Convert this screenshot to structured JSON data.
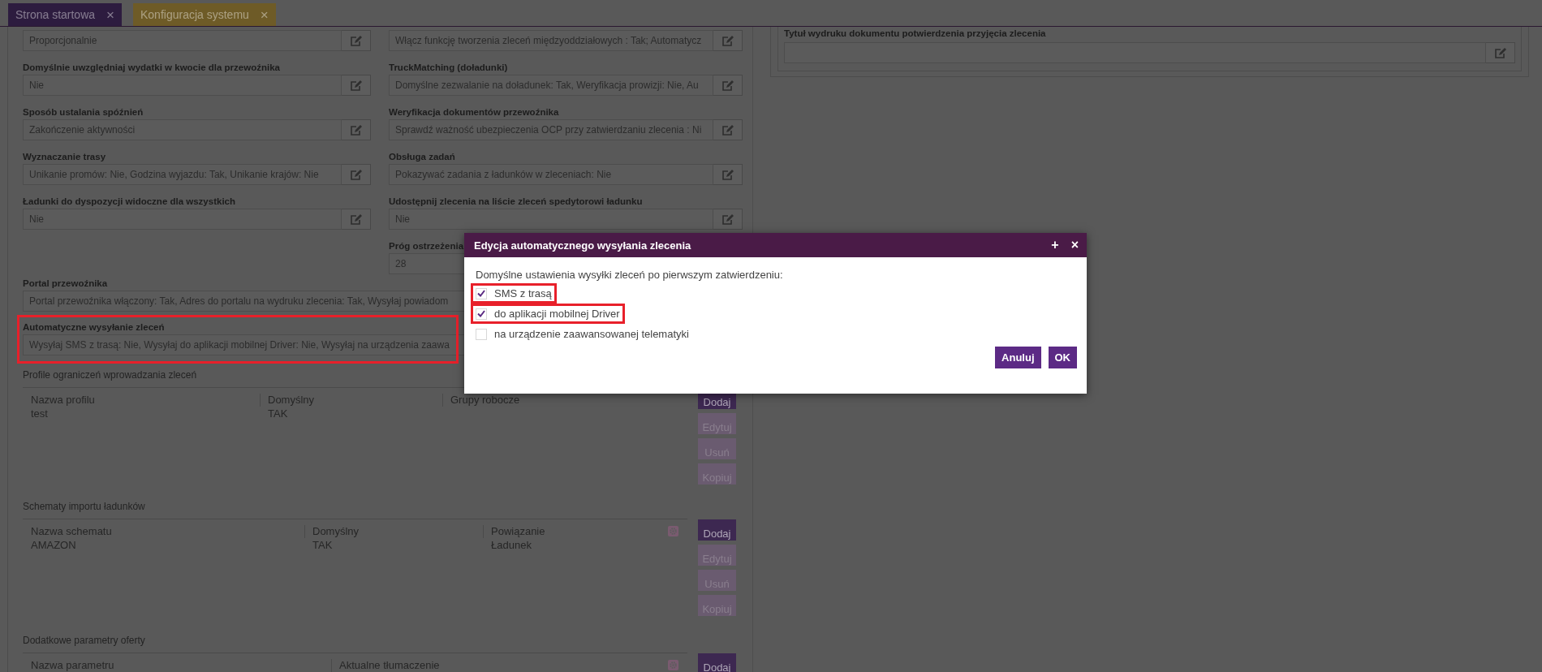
{
  "tabs": [
    {
      "label": "Strona startowa",
      "color": "#2d1c3f",
      "close": "×"
    },
    {
      "label": "Konfiguracja systemu",
      "color": "#6e5b27",
      "close": "×"
    }
  ],
  "settings": {
    "columns": [
      [
        {
          "value": "Proporcjonalnie",
          "editable": true
        },
        {
          "label": "Domyślnie uwzględniaj wydatki w kwocie dla przewoźnika",
          "value": "Nie",
          "editable": true
        },
        {
          "label": "Sposób ustalania spóźnień",
          "value": "Zakończenie aktywności",
          "editable": true
        },
        {
          "label": "Wyznaczanie trasy",
          "value": "Unikanie promów: Nie, Godzina wyjazdu: Tak, Unikanie krajów: Nie",
          "editable": true
        },
        {
          "label": "Ładunki do dyspozycji widoczne dla wszystkich",
          "value": "Nie",
          "editable": true
        }
      ],
      [
        {
          "value": "Włącz funkcję tworzenia zleceń międzyoddziałowych : Tak; Automatycz",
          "editable": true
        },
        {
          "label": "TruckMatching (doładunki)",
          "value": "Domyślne zezwalanie na doładunek: Tak, Weryfikacja prowizji: Nie, Au",
          "editable": true
        },
        {
          "label": "Weryfikacja dokumentów przewoźnika",
          "value": "Sprawdź ważność ubezpieczenia OCP przy zatwierdzaniu zlecenia : Ni",
          "editable": true
        },
        {
          "label": "Obsługa zadań",
          "value": "Pokazywać zadania z ładunków w zleceniach: Nie",
          "editable": true
        },
        {
          "label": "Udostępnij zlecenia na liście zleceń spedytorowi ładunku",
          "value": "Nie",
          "editable": true
        },
        {
          "label": "Próg ostrzeżenia",
          "value": "28",
          "editable": false
        }
      ]
    ],
    "wide_fields": [
      {
        "label": "Portal przewoźnika",
        "value": "Portal przewoźnika włączony: Tak, Adres do portalu na wydruku zlecenia: Tak, Wysyłaj powiadom",
        "editable": false,
        "highlighted": false
      },
      {
        "label": "Automatyczne wysyłanie zleceń",
        "value": "Wysyłaj SMS z trasą: Nie, Wysyłaj do aplikacji mobilnej Driver: Nie, Wysyłaj na urządzenia zaawa",
        "editable": false,
        "highlighted": true
      }
    ]
  },
  "tables": [
    {
      "title": "Profile ograniczeń wprowadzania zleceń",
      "columns": [
        "Nazwa profilu",
        "Domyślny",
        "Grupy robocze"
      ],
      "rows": [
        [
          "test",
          "TAK"
        ]
      ],
      "settings_icon": false,
      "buttons": [
        {
          "label": "Dodaj",
          "disabled": false
        },
        {
          "label": "Edytuj",
          "disabled": true
        },
        {
          "label": "Usuń",
          "disabled": true
        },
        {
          "label": "Kopiuj",
          "disabled": true
        }
      ]
    },
    {
      "title": "Schematy importu ładunków",
      "columns": [
        "Nazwa schematu",
        "Domyślny",
        "Powiązanie"
      ],
      "rows": [
        [
          "AMAZON",
          "TAK",
          "Ładunek"
        ]
      ],
      "settings_icon": true,
      "buttons": [
        {
          "label": "Dodaj",
          "disabled": false
        },
        {
          "label": "Edytuj",
          "disabled": true
        },
        {
          "label": "Usuń",
          "disabled": true
        },
        {
          "label": "Kopiuj",
          "disabled": true
        }
      ]
    },
    {
      "title": "Dodatkowe parametry oferty",
      "columns": [
        "Nazwa parametru",
        "Aktualne tłumaczenie"
      ],
      "settings_icon": true,
      "buttons": [
        {
          "label": "Dodaj",
          "disabled": false
        }
      ]
    }
  ],
  "print_panel": {
    "label": "Tytuł wydruku dokumentu potwierdzenia przyjęcia zlecenia",
    "editable": true
  },
  "dialog": {
    "title": "Edycja automatycznego wysyłania zlecenia",
    "header_buttons": [
      "+",
      "×"
    ],
    "prompt": "Domyślne ustawienia wysyłki zleceń po pierwszym zatwierdzeniu:",
    "options": [
      {
        "label": "SMS z trasą",
        "checked": true,
        "highlighted": true
      },
      {
        "label": "do aplikacji mobilnej Driver",
        "checked": true,
        "highlighted": true
      },
      {
        "label": "na urządzenie zaawansowanej telematyki",
        "checked": false,
        "highlighted": false
      }
    ],
    "buttons": [
      "Anuluj",
      "OK"
    ]
  }
}
